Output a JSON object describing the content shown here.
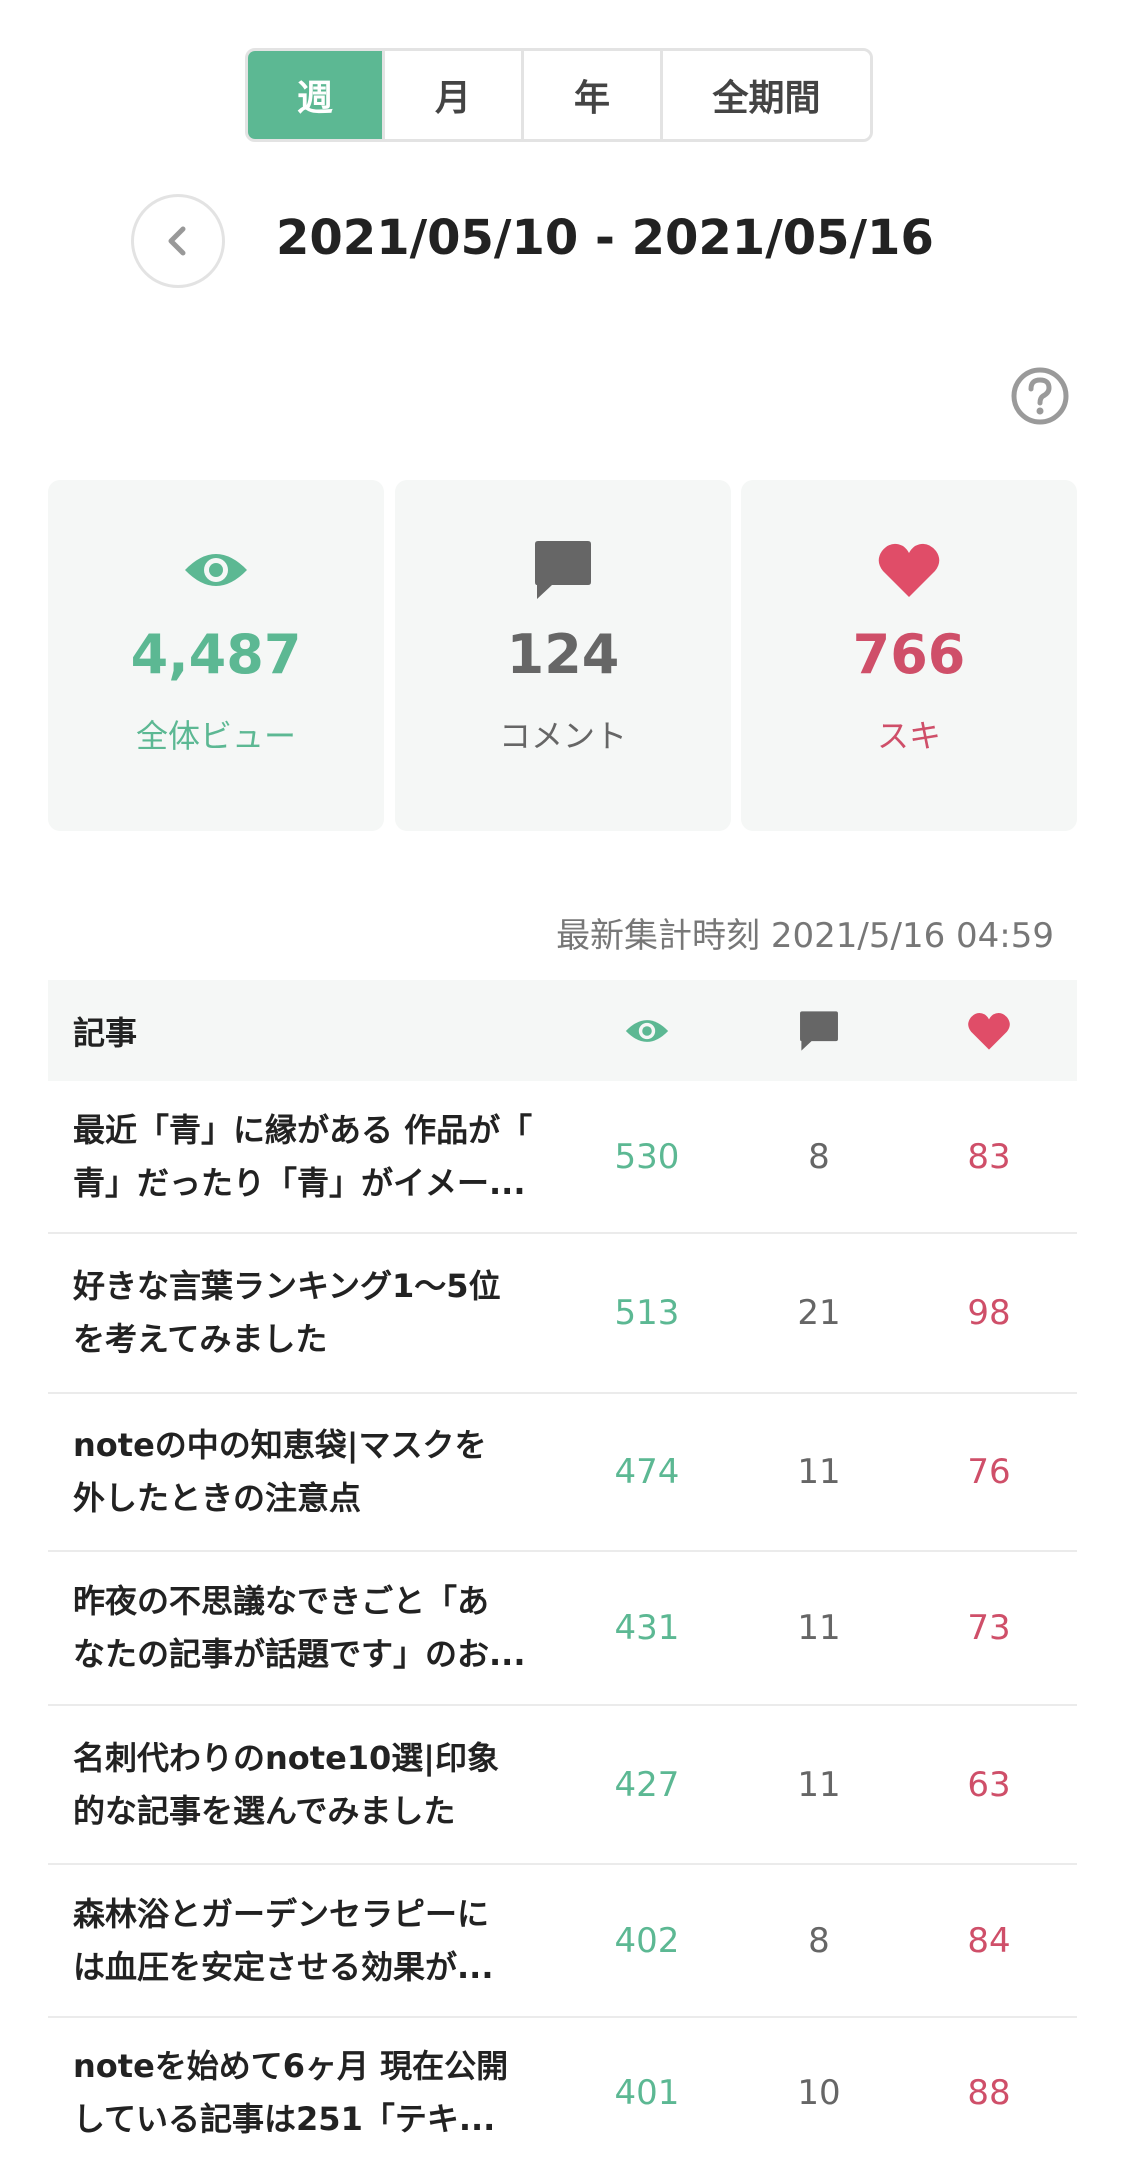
{
  "period_tabs": [
    {
      "label": "週",
      "active": true
    },
    {
      "label": "月",
      "active": false
    },
    {
      "label": "年",
      "active": false
    },
    {
      "label": "全期間",
      "active": false
    }
  ],
  "date_range": "2021/05/10 - 2021/05/16",
  "icons": {
    "back": "chevron-left-icon",
    "help": "question-circle-icon",
    "views": "eye-icon",
    "comments": "comment-bubble-icon",
    "likes": "heart-icon"
  },
  "colors": {
    "accent_green": "#5cb893",
    "comment_gray": "#666666",
    "like_pink": "#cf4f69",
    "card_bg": "#f5f7f6"
  },
  "summary": {
    "views": {
      "value": "4,487",
      "label": "全体ビュー"
    },
    "comments": {
      "value": "124",
      "label": "コメント"
    },
    "likes": {
      "value": "766",
      "label": "スキ"
    }
  },
  "last_updated": "最新集計時刻 2021/5/16 04:59",
  "table": {
    "header_title": "記事",
    "rows": [
      {
        "title_line1": "最近「青」に縁がある 作品が「",
        "title_line2": "青」だったり「青」がイメー...",
        "views": "530",
        "comments": "8",
        "likes": "83"
      },
      {
        "title_line1": "好きな言葉ランキング1〜5位",
        "title_line2": "を考えてみました",
        "views": "513",
        "comments": "21",
        "likes": "98"
      },
      {
        "title_line1": "noteの中の知恵袋|マスクを",
        "title_line2": "外したときの注意点",
        "views": "474",
        "comments": "11",
        "likes": "76"
      },
      {
        "title_line1": "昨夜の不思議なできごと「あ",
        "title_line2": "なたの記事が話題です」のお...",
        "views": "431",
        "comments": "11",
        "likes": "73"
      },
      {
        "title_line1": "名刺代わりのnote10選|印象",
        "title_line2": "的な記事を選んでみました",
        "views": "427",
        "comments": "11",
        "likes": "63"
      },
      {
        "title_line1": "森林浴とガーデンセラピーに",
        "title_line2": "は血圧を安定させる効果が...",
        "views": "402",
        "comments": "8",
        "likes": "84"
      },
      {
        "title_line1": "noteを始めて6ヶ月 現在公開",
        "title_line2": "している記事は251「テキ...",
        "views": "401",
        "comments": "10",
        "likes": "88"
      }
    ]
  }
}
